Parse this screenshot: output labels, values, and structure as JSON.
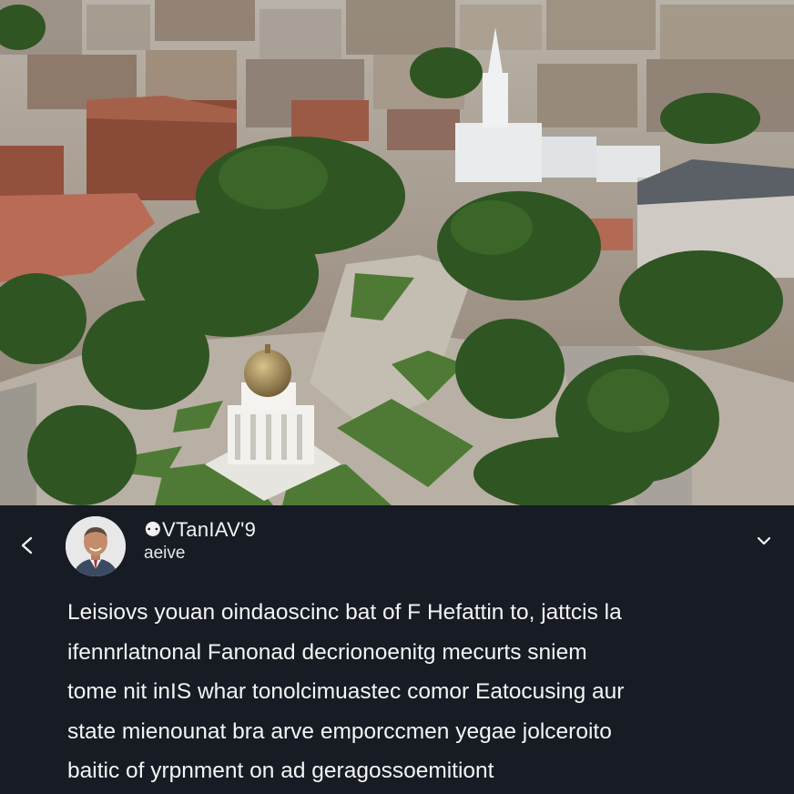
{
  "post": {
    "author_name": "⚉VTanIAV'9",
    "author_sub": "aeive",
    "body_lines": [
      "Leisiovs youan oindaoscinc bat of F Hefattin to, jattcis la",
      "ifennrlatnonal Fanonad decrionoenitg mecurts sniem",
      "tome nit inIS whar tonolcimuastec comor Eatocusing aur",
      "state mienounat bra arve emporccmen yegae jolceroito",
      "baitic of yrpnment on ad geragossoemitiont"
    ]
  },
  "icons": {
    "back": "chevron-left-icon",
    "menu": "chevron-down-icon"
  },
  "colors": {
    "panel_bg": "#161b24",
    "text": "#f4f4f4"
  }
}
